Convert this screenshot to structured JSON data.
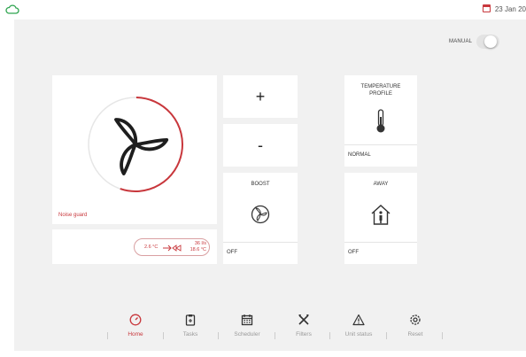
{
  "header": {
    "date": "23 Jan 20",
    "colors": {
      "accent": "#c8373c",
      "cloud": "#2ea44f"
    },
    "icons": [
      "cloud-icon",
      "calendar-icon"
    ]
  },
  "manual": {
    "label": "MANUAL",
    "enabled": false
  },
  "fan": {
    "caption": "Noise guard",
    "icon": "fan-icon",
    "level": 0.55
  },
  "temperatures": {
    "outdoor": "2.6 °C",
    "flow": "36 l/s",
    "supply": "18.6 °C"
  },
  "controls": {
    "increase_label": "+",
    "decrease_label": "-"
  },
  "boost": {
    "title": "BOOST",
    "status": "OFF",
    "icon": "boost-fan-icon"
  },
  "temperature_profile": {
    "title_line1": "TEMPERATURE",
    "title_line2": "PROFILE",
    "status": "NORMAL",
    "icon": "thermometer-icon"
  },
  "away": {
    "title": "AWAY",
    "status": "OFF",
    "icon": "away-house-icon"
  },
  "nav": {
    "active": "home",
    "items": [
      {
        "label": "Home",
        "icon": "home-gauge-icon"
      },
      {
        "label": "Tasks",
        "icon": "tasks-icon"
      },
      {
        "label": "Scheduler",
        "icon": "scheduler-icon"
      },
      {
        "label": "Filters",
        "icon": "filters-icon"
      },
      {
        "label": "Unit status",
        "icon": "warning-icon"
      },
      {
        "label": "Reset",
        "icon": "reset-gear-icon"
      }
    ]
  }
}
